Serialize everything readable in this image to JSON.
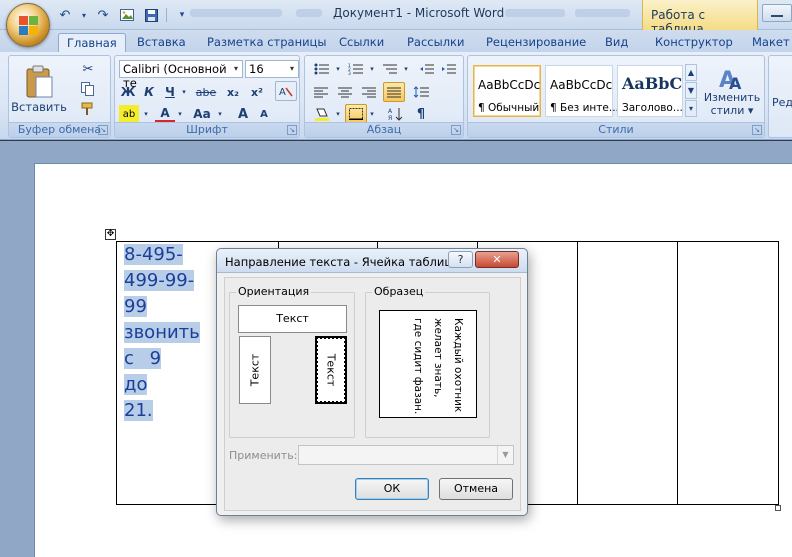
{
  "window": {
    "title": "Документ1 - Microsoft Word",
    "contextual_tab_label": "Работа с таблица..."
  },
  "tabs": [
    "Главная",
    "Вставка",
    "Разметка страницы",
    "Ссылки",
    "Рассылки",
    "Рецензирование",
    "Вид",
    "Конструктор",
    "Макет"
  ],
  "ribbon": {
    "clipboard": {
      "label": "Буфер обмена",
      "paste_label": "Вставить"
    },
    "font": {
      "label": "Шрифт",
      "font_name": "Calibri (Основной те",
      "font_size": "16",
      "bold": "Ж",
      "italic": "К",
      "underline": "Ч",
      "strike": "abe",
      "subscript": "x₂",
      "superscript": "x²",
      "grow": "A",
      "change_case": "Aa",
      "highlight": "ab",
      "color": "A"
    },
    "paragraph": {
      "label": "Абзац",
      "pilcrow": "¶"
    },
    "styles": {
      "label": "Стили",
      "items": [
        {
          "preview": "AaBbCcDc",
          "name": "¶ Обычный"
        },
        {
          "preview": "AaBbCcDc",
          "name": "¶ Без инте..."
        },
        {
          "preview": "AaBbC",
          "name": "Заголово..."
        }
      ],
      "change_styles_label_1": "Изменить",
      "change_styles_label_2": "стили",
      "edit_label": "Реда"
    }
  },
  "document": {
    "cell_lines": [
      "8-495-",
      "499-99-",
      "99",
      "звонить",
      "с 9 до",
      "21."
    ]
  },
  "dialog": {
    "title": "Направление текста - Ячейка таблицы",
    "help_label": "?",
    "close_label": "✕",
    "orientation_legend": "Ориентация",
    "sample_legend": "Образец",
    "orient_label": "Текст",
    "sample_lines": [
      "Каждый охотник",
      "желает знать,",
      "где сидит фазан."
    ],
    "apply_label": "Применить:",
    "ok_label": "ОК",
    "cancel_label": "Отмена"
  }
}
